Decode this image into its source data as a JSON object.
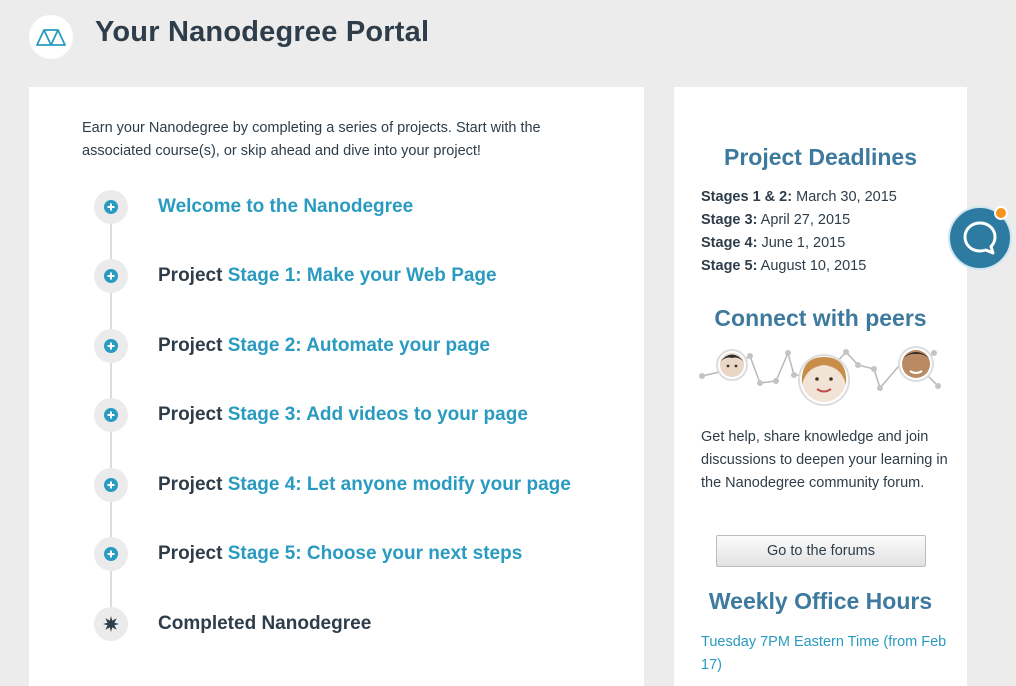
{
  "header": {
    "title": "Your Nanodegree Portal",
    "logo_icon": "udacity-logo-icon"
  },
  "main": {
    "intro": "Earn your Nanodegree by completing a series of projects. Start with the associated course(s), or skip ahead and dive into your project!",
    "stages": [
      {
        "prefix": "",
        "link": "Welcome to the Nanodegree",
        "icon": "plus-circle-icon"
      },
      {
        "prefix": "Project ",
        "link": "Stage 1: Make your Web Page",
        "icon": "plus-circle-icon"
      },
      {
        "prefix": "Project ",
        "link": "Stage 2: Automate your page",
        "icon": "plus-circle-icon"
      },
      {
        "prefix": "Project ",
        "link": "Stage 3: Add videos to your page",
        "icon": "plus-circle-icon"
      },
      {
        "prefix": "Project ",
        "link": "Stage 4: Let anyone modify your page",
        "icon": "plus-circle-icon"
      },
      {
        "prefix": "Project ",
        "link": "Stage 5: Choose your next steps",
        "icon": "plus-circle-icon"
      }
    ],
    "completed": "Completed Nanodegree"
  },
  "sidebar": {
    "deadlines_heading": "Project Deadlines",
    "deadlines": [
      {
        "label": "Stages 1 & 2:",
        "date": "March 30, 2015"
      },
      {
        "label": "Stage 3:",
        "date": "April 27, 2015"
      },
      {
        "label": "Stage 4:",
        "date": "June 1, 2015"
      },
      {
        "label": "Stage 5:",
        "date": "August 10, 2015"
      }
    ],
    "peers_heading": "Connect with peers",
    "peers_text": "Get help, share knowledge and join discussions to deepen your learning in the Nanodegree community forum.",
    "forums_button": "Go to the forums",
    "office_heading": "Weekly Office Hours",
    "office_link": "Tuesday 7PM Eastern Time (from Feb 17)"
  },
  "colors": {
    "background": "#ececec",
    "link": "#2a9bc0",
    "heading": "#3e7a9e",
    "text": "#2e3d49",
    "chat": "#2d7ba0",
    "notify": "#f7941d"
  },
  "chat": {
    "icon": "chat-bubble-icon"
  }
}
